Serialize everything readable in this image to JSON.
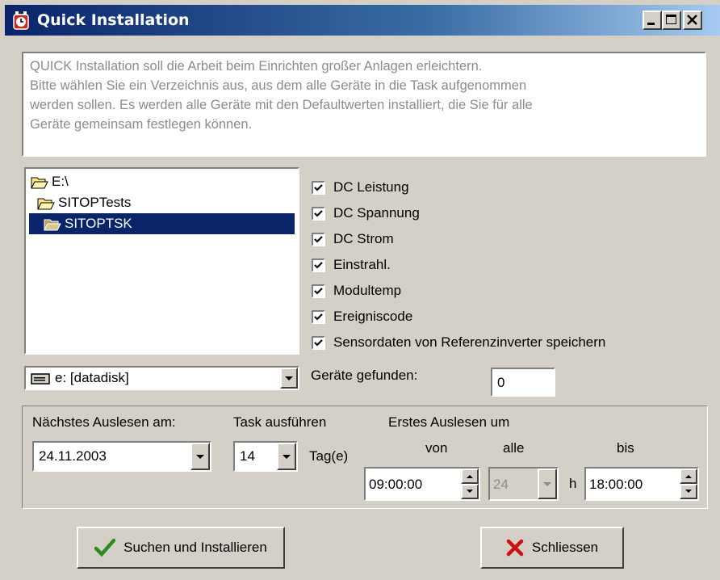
{
  "window": {
    "title": "Quick Installation",
    "controls": [
      "minimize-icon",
      "maximize-icon",
      "close-icon"
    ]
  },
  "description": [
    "QUICK Installation soll die Arbeit beim Einrichten großer Anlagen erleichtern.",
    "Bitte wählen Sie ein Verzeichnis aus, aus dem alle Geräte in die Task aufgenommen",
    "werden sollen. Es werden alle Geräte mit den Defaultwerten installiert, die Sie für alle",
    "Geräte gemeinsam festlegen können."
  ],
  "tree": {
    "items": [
      {
        "label": "E:\\",
        "icon": "folder-open-icon",
        "selected": false
      },
      {
        "label": "SITOPTests",
        "icon": "folder-open-icon",
        "selected": false
      },
      {
        "label": "SITOPTSK",
        "icon": "folder-open-icon",
        "selected": true
      }
    ]
  },
  "drive": {
    "value": "e: [datadisk]",
    "icon": "drive-icon"
  },
  "checkboxes": [
    {
      "label": "DC Leistung",
      "checked": true
    },
    {
      "label": "DC Spannung",
      "checked": true
    },
    {
      "label": "DC Strom",
      "checked": true
    },
    {
      "label": "Einstrahl.",
      "checked": true
    },
    {
      "label": "Modultemp",
      "checked": true
    },
    {
      "label": "Ereigniscode",
      "checked": true
    },
    {
      "label": "Sensordaten von Referenzinverter speichern",
      "checked": true
    }
  ],
  "found": {
    "label": "Geräte gefunden:",
    "value": "0"
  },
  "schedule": {
    "next_label": "Nächstes Auslesen am:",
    "next_date": "24.11.2003",
    "task_label": "Task ausführen",
    "task_days": "14",
    "days_unit": "Tag(e)",
    "first_label": "Erstes Auslesen um",
    "from_label": "von",
    "from_value": "09:00:00",
    "every_label": "alle",
    "every_value": "24",
    "hours_unit": "h",
    "to_label": "bis",
    "to_value": "18:00:00"
  },
  "buttons": {
    "search_install": "Suchen und Installieren",
    "close": "Schliessen"
  },
  "colors": {
    "titlebar_start": "#0a246a",
    "titlebar_end": "#a6caf0",
    "selection": "#0a246a",
    "face": "#d4d0c8",
    "check_icon": "#2e8b1f",
    "close_icon": "#cc1111"
  }
}
